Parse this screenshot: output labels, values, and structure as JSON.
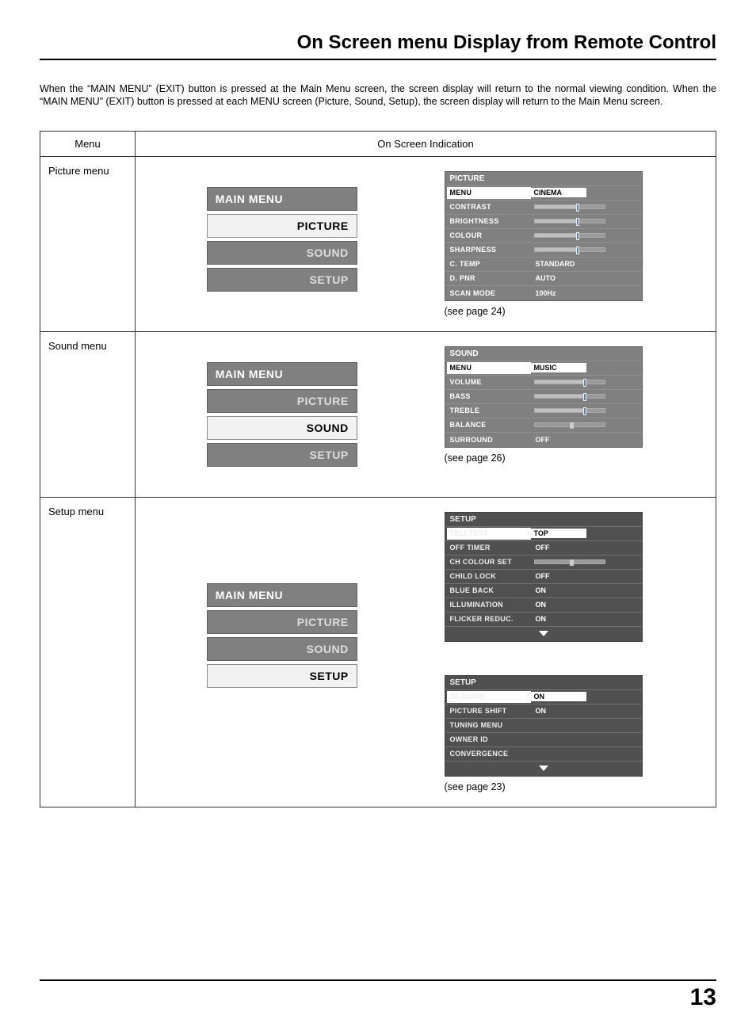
{
  "title": "On Screen menu Display from Remote Control",
  "intro": "When the “MAIN MENU” (EXIT) button is pressed at the Main Menu screen, the screen display will return to the normal viewing condition. When the “MAIN MENU” (EXIT) button is pressed at each MENU screen (Picture, Sound, Setup), the screen display will return to the Main Menu screen.",
  "headers": {
    "menu": "Menu",
    "indication": "On Screen Indication"
  },
  "rows": {
    "picture": {
      "label": "Picture menu",
      "main": {
        "title": "MAIN MENU",
        "items": [
          "PICTURE",
          "SOUND",
          "SETUP"
        ],
        "selected": 0
      },
      "see": "(see page 24)"
    },
    "sound": {
      "label": "Sound menu",
      "main": {
        "title": "MAIN MENU",
        "items": [
          "PICTURE",
          "SOUND",
          "SETUP"
        ],
        "selected": 1
      },
      "see": "(see page 26)"
    },
    "setup": {
      "label": "Setup menu",
      "main": {
        "title": "MAIN MENU",
        "items": [
          "PICTURE",
          "SOUND",
          "SETUP"
        ],
        "selected": 2
      },
      "see": "(see page 23)"
    }
  },
  "panels": {
    "picture": {
      "title": "PICTURE",
      "rows": [
        {
          "label": "MENU",
          "type": "hl",
          "value": "CINEMA"
        },
        {
          "label": "CONTRAST",
          "type": "slider",
          "pos": 60
        },
        {
          "label": "BRIGHTNESS",
          "type": "slider",
          "pos": 60
        },
        {
          "label": "COLOUR",
          "type": "slider",
          "pos": 60
        },
        {
          "label": "SHARPNESS",
          "type": "slider",
          "pos": 60
        },
        {
          "label": "C. TEMP",
          "type": "text",
          "value": "STANDARD"
        },
        {
          "label": "D.  PNR",
          "type": "text",
          "value": "AUTO"
        },
        {
          "label": "SCAN MODE",
          "type": "text",
          "value": "100Hz"
        }
      ]
    },
    "sound": {
      "title": "SOUND",
      "rows": [
        {
          "label": "MENU",
          "type": "hl",
          "value": "MUSIC"
        },
        {
          "label": "VOLUME",
          "type": "slider",
          "pos": 70
        },
        {
          "label": "BASS",
          "type": "slider",
          "pos": 70
        },
        {
          "label": "TREBLE",
          "type": "slider",
          "pos": 70
        },
        {
          "label": "BALANCE",
          "type": "center"
        },
        {
          "label": "SURROUND",
          "type": "text",
          "value": "OFF"
        }
      ]
    },
    "setup1": {
      "title": "SETUP",
      "rows": [
        {
          "label": "TELETEXT",
          "type": "hl2",
          "value": "TOP"
        },
        {
          "label": "OFF TIMER",
          "type": "text",
          "value": "OFF"
        },
        {
          "label": "CH COLOUR SET",
          "type": "center"
        },
        {
          "label": "CHILD LOCK",
          "type": "text",
          "value": "OFF"
        },
        {
          "label": "BLUE BACK",
          "type": "text",
          "value": "ON"
        },
        {
          "label": "ILLUMINATION",
          "type": "text",
          "value": "ON"
        },
        {
          "label": "FLICKER REDUC.",
          "type": "text",
          "value": "ON"
        }
      ],
      "arrow": true
    },
    "setup2": {
      "title": "SETUP",
      "rows": [
        {
          "label": "3D-COMB",
          "type": "hl2",
          "value": "ON"
        },
        {
          "label": "PICTURE SHIFT",
          "type": "text",
          "value": "ON"
        },
        {
          "label": "TUNING MENU",
          "type": "blank"
        },
        {
          "label": "OWNER ID",
          "type": "blank"
        },
        {
          "label": "CONVERGENCE",
          "type": "blank"
        }
      ],
      "arrow": true
    }
  },
  "pageNumber": "13"
}
